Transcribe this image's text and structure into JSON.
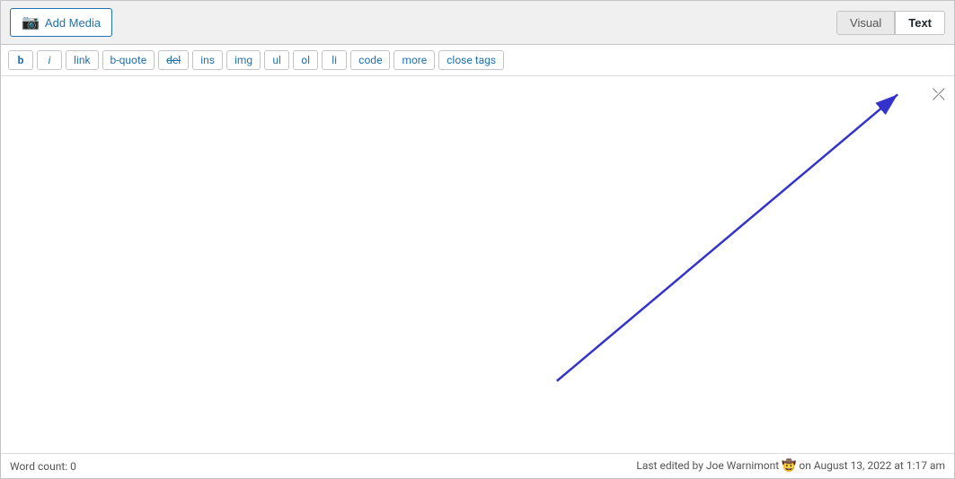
{
  "editor": {
    "add_media_label": "Add Media",
    "tab_visual": "Visual",
    "tab_text": "Text",
    "toolbar_buttons": [
      {
        "label": "b",
        "id": "bold"
      },
      {
        "label": "i",
        "id": "italic"
      },
      {
        "label": "link",
        "id": "link"
      },
      {
        "label": "b-quote",
        "id": "bquote"
      },
      {
        "label": "del",
        "id": "del"
      },
      {
        "label": "ins",
        "id": "ins"
      },
      {
        "label": "img",
        "id": "img"
      },
      {
        "label": "ul",
        "id": "ul"
      },
      {
        "label": "ol",
        "id": "ol"
      },
      {
        "label": "li",
        "id": "li"
      },
      {
        "label": "code",
        "id": "code"
      },
      {
        "label": "more",
        "id": "more"
      },
      {
        "label": "close tags",
        "id": "closetags"
      }
    ],
    "word_count_label": "Word count: 0",
    "last_edited_label": "Last edited by Joe Warnimont",
    "last_edited_suffix": " on August 13, 2022 at 1:17 am",
    "expand_icon": "⤢"
  }
}
